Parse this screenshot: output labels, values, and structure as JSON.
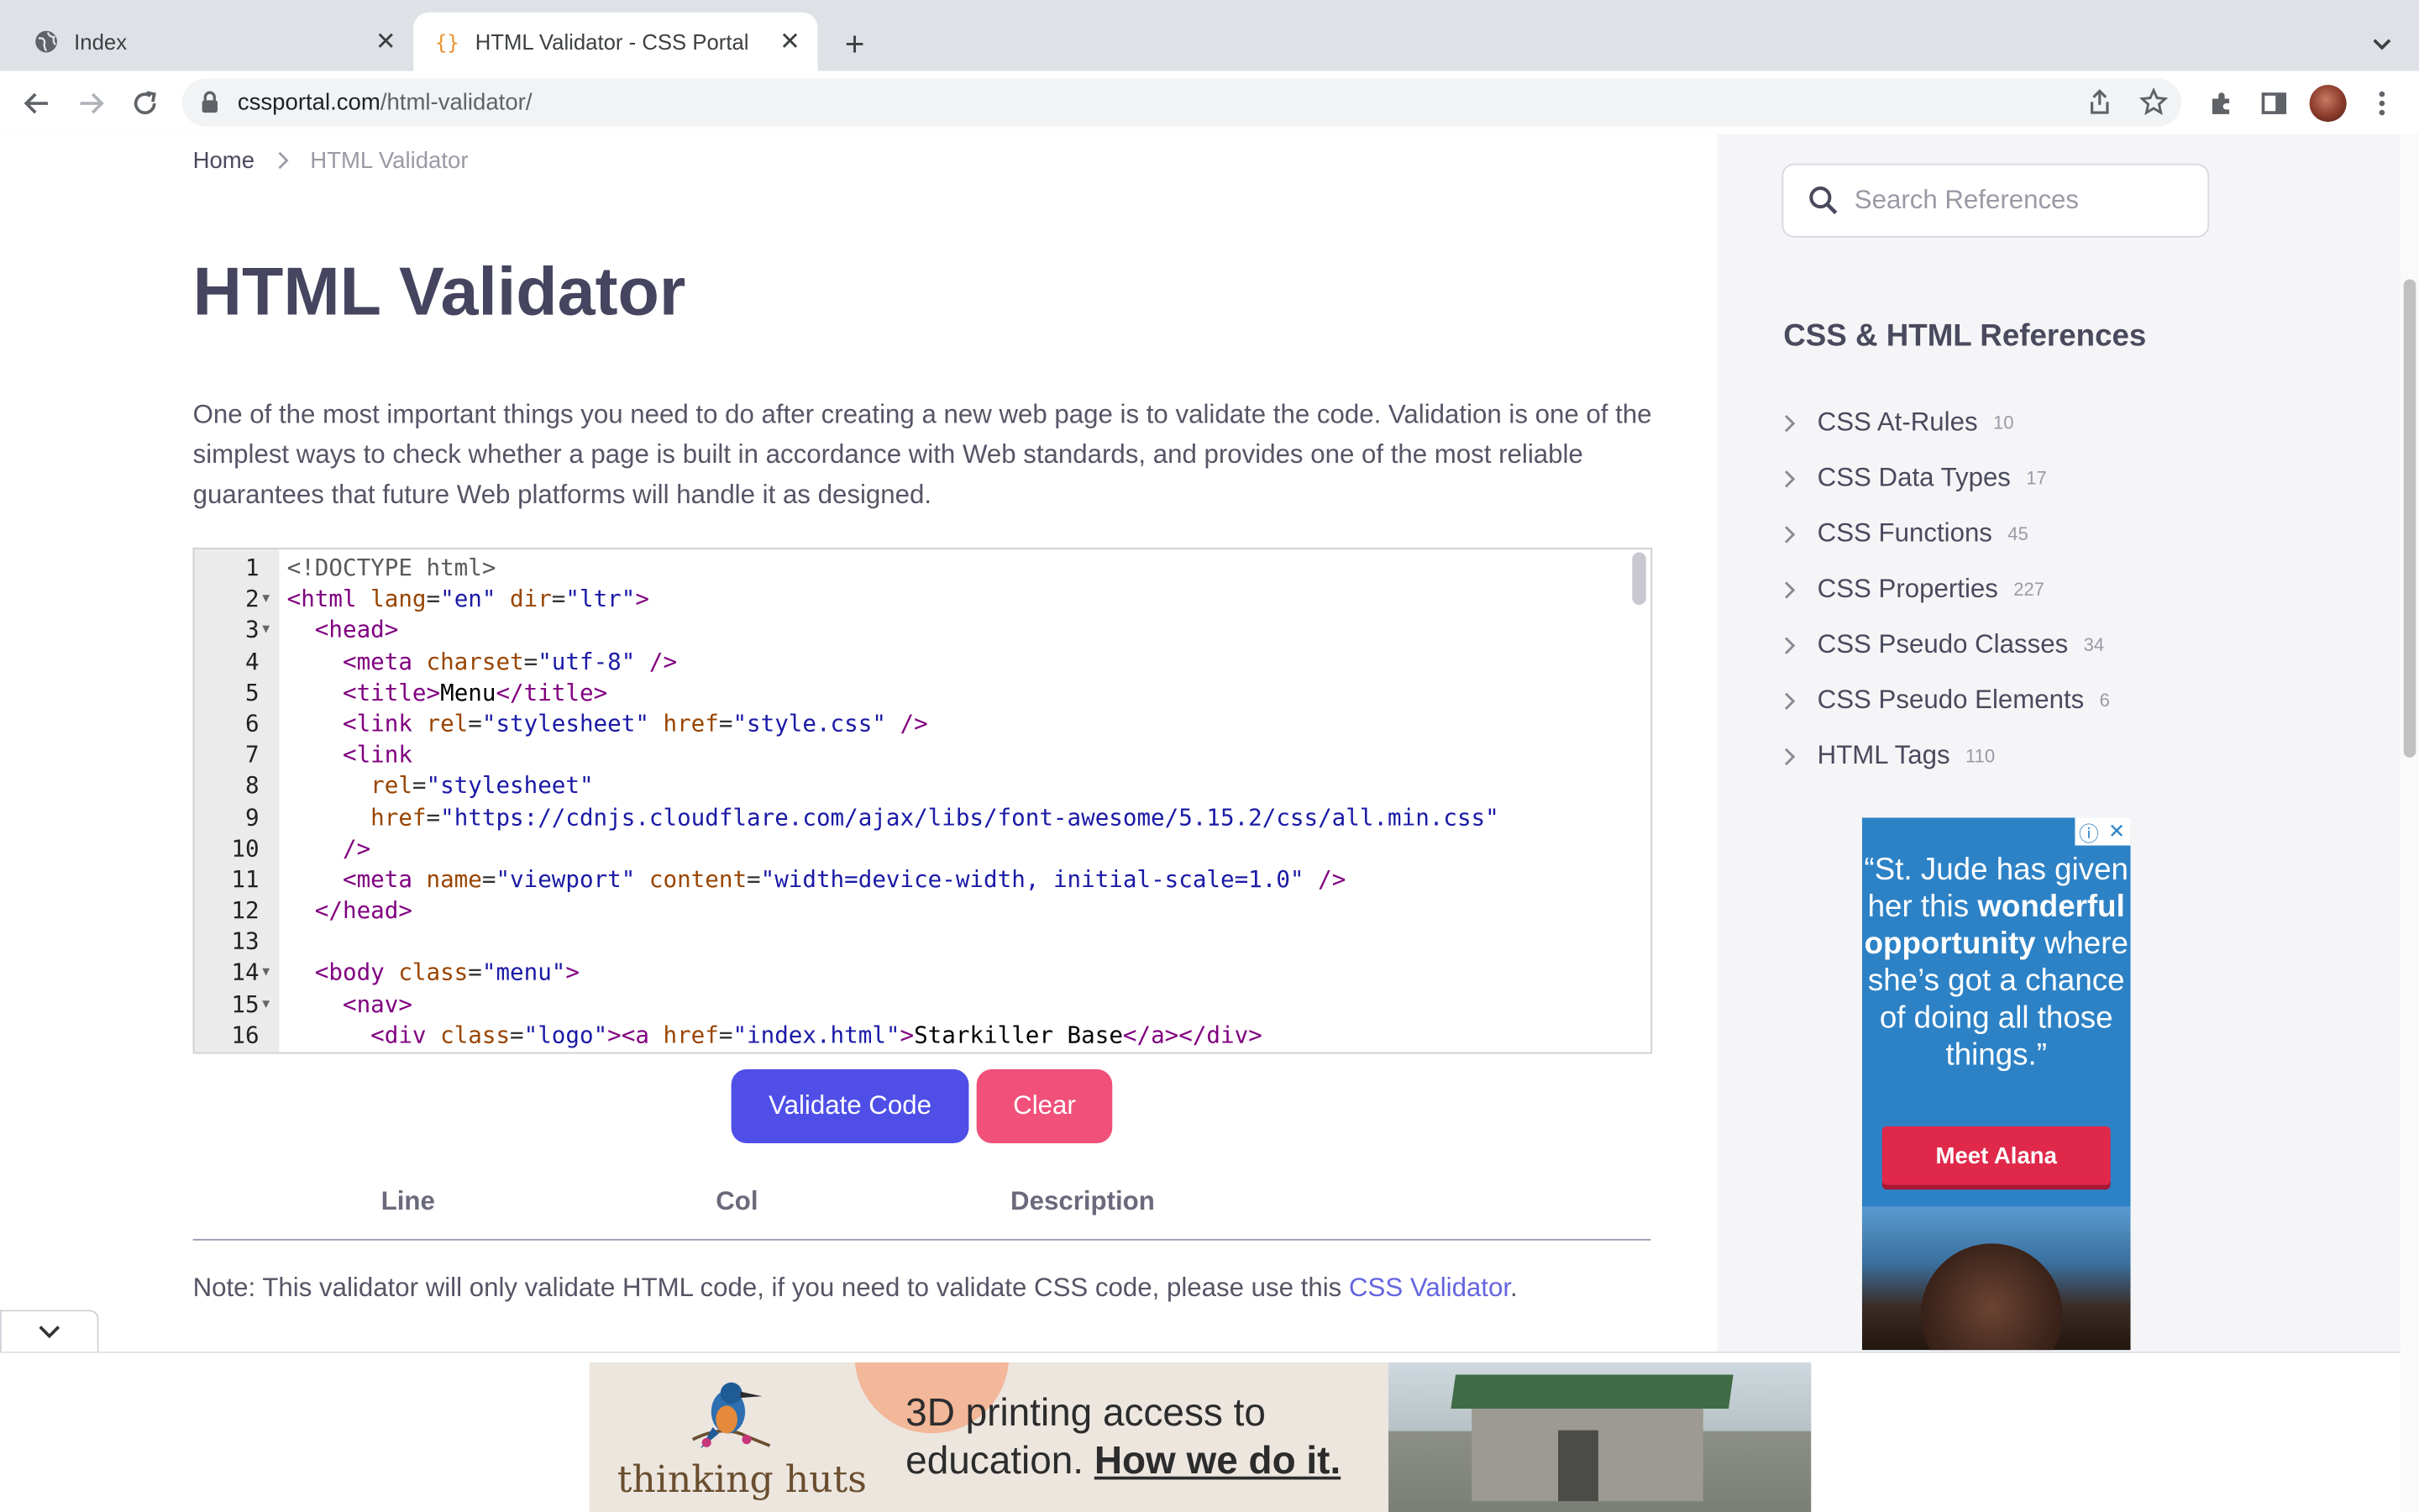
{
  "browser": {
    "tabs": [
      {
        "title": "Index",
        "active": false
      },
      {
        "title": "HTML Validator - CSS Portal",
        "active": true
      }
    ],
    "url_domain": "cssportal.com",
    "url_path": "/html-validator/"
  },
  "breadcrumb": {
    "home": "Home",
    "current": "HTML Validator"
  },
  "page": {
    "title": "HTML Validator",
    "intro": "One of the most important things you need to do after creating a new web page is to validate the code. Validation is one of the simplest ways to check whether a page is built in accordance with Web standards, and provides one of the most reliable guarantees that future Web platforms will handle it as designed."
  },
  "editor": {
    "lines": [
      {
        "n": "1",
        "fold": false,
        "tokens": [
          [
            "doc",
            "<!DOCTYPE html>"
          ]
        ]
      },
      {
        "n": "2",
        "fold": true,
        "tokens": [
          [
            "tag",
            "<html "
          ],
          [
            "attr",
            "lang"
          ],
          [
            "eq",
            "="
          ],
          [
            "str",
            "\"en\""
          ],
          [
            "txt",
            " "
          ],
          [
            "attr",
            "dir"
          ],
          [
            "eq",
            "="
          ],
          [
            "str",
            "\"ltr\""
          ],
          [
            "tag",
            ">"
          ]
        ]
      },
      {
        "n": "3",
        "fold": true,
        "tokens": [
          [
            "txt",
            "  "
          ],
          [
            "tag",
            "<head>"
          ]
        ]
      },
      {
        "n": "4",
        "fold": false,
        "tokens": [
          [
            "txt",
            "    "
          ],
          [
            "tag",
            "<meta "
          ],
          [
            "attr",
            "charset"
          ],
          [
            "eq",
            "="
          ],
          [
            "str",
            "\"utf-8\""
          ],
          [
            "tag",
            " />"
          ]
        ]
      },
      {
        "n": "5",
        "fold": false,
        "tokens": [
          [
            "txt",
            "    "
          ],
          [
            "tag",
            "<title>"
          ],
          [
            "txt",
            "Menu"
          ],
          [
            "tag",
            "</title>"
          ]
        ]
      },
      {
        "n": "6",
        "fold": false,
        "tokens": [
          [
            "txt",
            "    "
          ],
          [
            "tag",
            "<link "
          ],
          [
            "attr",
            "rel"
          ],
          [
            "eq",
            "="
          ],
          [
            "str",
            "\"stylesheet\""
          ],
          [
            "txt",
            " "
          ],
          [
            "attr",
            "href"
          ],
          [
            "eq",
            "="
          ],
          [
            "str",
            "\"style.css\""
          ],
          [
            "tag",
            " />"
          ]
        ]
      },
      {
        "n": "7",
        "fold": false,
        "tokens": [
          [
            "txt",
            "    "
          ],
          [
            "tag",
            "<link"
          ]
        ]
      },
      {
        "n": "8",
        "fold": false,
        "tokens": [
          [
            "txt",
            "      "
          ],
          [
            "attr",
            "rel"
          ],
          [
            "eq",
            "="
          ],
          [
            "str",
            "\"stylesheet\""
          ]
        ]
      },
      {
        "n": "9",
        "fold": false,
        "tokens": [
          [
            "txt",
            "      "
          ],
          [
            "attr",
            "href"
          ],
          [
            "eq",
            "="
          ],
          [
            "str",
            "\"https://cdnjs.cloudflare.com/ajax/libs/font-awesome/5.15.2/css/all.min.css\""
          ]
        ]
      },
      {
        "n": "10",
        "fold": false,
        "tokens": [
          [
            "txt",
            "    "
          ],
          [
            "tag",
            "/>"
          ]
        ]
      },
      {
        "n": "11",
        "fold": false,
        "tokens": [
          [
            "txt",
            "    "
          ],
          [
            "tag",
            "<meta "
          ],
          [
            "attr",
            "name"
          ],
          [
            "eq",
            "="
          ],
          [
            "str",
            "\"viewport\""
          ],
          [
            "txt",
            " "
          ],
          [
            "attr",
            "content"
          ],
          [
            "eq",
            "="
          ],
          [
            "str",
            "\"width=device-width, initial-scale=1.0\""
          ],
          [
            "tag",
            " />"
          ]
        ]
      },
      {
        "n": "12",
        "fold": false,
        "tokens": [
          [
            "txt",
            "  "
          ],
          [
            "tag",
            "</head>"
          ]
        ]
      },
      {
        "n": "13",
        "fold": false,
        "tokens": []
      },
      {
        "n": "14",
        "fold": true,
        "tokens": [
          [
            "txt",
            "  "
          ],
          [
            "tag",
            "<body "
          ],
          [
            "attr",
            "class"
          ],
          [
            "eq",
            "="
          ],
          [
            "str",
            "\"menu\""
          ],
          [
            "tag",
            ">"
          ]
        ]
      },
      {
        "n": "15",
        "fold": true,
        "tokens": [
          [
            "txt",
            "    "
          ],
          [
            "tag",
            "<nav>"
          ]
        ]
      },
      {
        "n": "16",
        "fold": false,
        "tokens": [
          [
            "txt",
            "      "
          ],
          [
            "tag",
            "<div "
          ],
          [
            "attr",
            "class"
          ],
          [
            "eq",
            "="
          ],
          [
            "str",
            "\"logo\""
          ],
          [
            "tag",
            "><a "
          ],
          [
            "attr",
            "href"
          ],
          [
            "eq",
            "="
          ],
          [
            "str",
            "\"index.html\""
          ],
          [
            "tag",
            ">"
          ],
          [
            "txt",
            "Starkiller Base"
          ],
          [
            "tag",
            "</a></div>"
          ]
        ]
      }
    ]
  },
  "buttons": {
    "validate": "Validate Code",
    "clear": "Clear"
  },
  "results": {
    "col_line": "Line",
    "col_col": "Col",
    "col_description": "Description"
  },
  "note": {
    "text": "Note: This validator will only validate HTML code, if you need to validate CSS code, please use this ",
    "link": "CSS Validator",
    "end": "."
  },
  "sidebar": {
    "search_placeholder": "Search References",
    "refs_title": "CSS & HTML References",
    "refs": [
      {
        "label": "CSS At-Rules",
        "count": "10"
      },
      {
        "label": "CSS Data Types",
        "count": "17"
      },
      {
        "label": "CSS Functions",
        "count": "45"
      },
      {
        "label": "CSS Properties",
        "count": "227"
      },
      {
        "label": "CSS Pseudo Classes",
        "count": "34"
      },
      {
        "label": "CSS Pseudo Elements",
        "count": "6"
      },
      {
        "label": "HTML Tags",
        "count": "110"
      }
    ]
  },
  "side_ad": {
    "quote_1": "“St. Jude has given her this ",
    "quote_bold": "wonderful opportunity",
    "quote_2": " where she’s got a chance of doing all those things.”",
    "cta": "Meet Alana"
  },
  "bottom_ad": {
    "brand": "thinking huts",
    "headline_1": "3D printing access to",
    "headline_2": "education. ",
    "headline_link": "How we do it."
  },
  "colors": {
    "accent": "#4f4fe8",
    "danger": "#f0507a",
    "heading": "#454560",
    "link": "#6565e0"
  }
}
